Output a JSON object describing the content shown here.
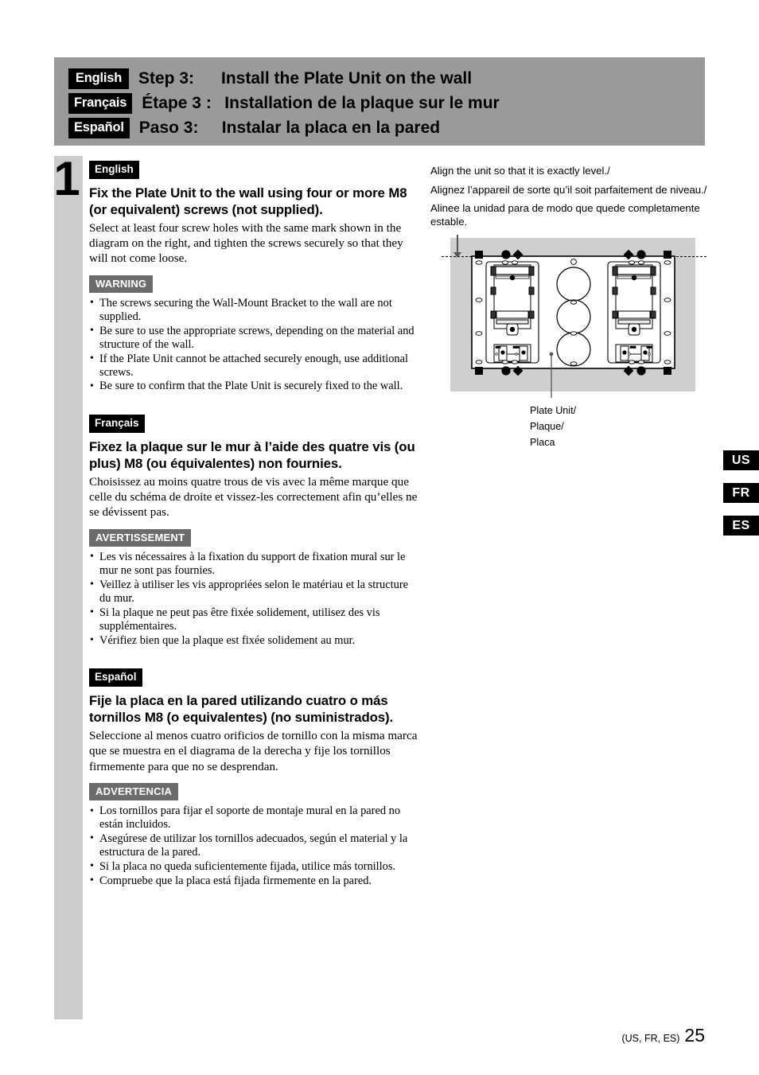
{
  "header": {
    "rows": [
      {
        "chip": "English",
        "step": "Step 3:",
        "title": "Install the Plate Unit on the wall"
      },
      {
        "chip": "Français",
        "step": "Étape 3 :",
        "title": "Installation de la plaque sur le mur"
      },
      {
        "chip": "Español",
        "step": "Paso 3:",
        "title": "Instalar la placa en la pared"
      }
    ],
    "band_color": "#9a9a9a"
  },
  "step": {
    "number": "1",
    "bar_color": "#cccccc"
  },
  "sections": [
    {
      "lang": "English",
      "heading": "Fix the Plate Unit to the wall using four or more M8 (or equivalent) screws (not supplied).",
      "body": "Select at least four screw holes with the same mark shown in the diagram on the right, and tighten the screws securely so that they will not come loose.",
      "warning_label": "WARNING",
      "bullets": [
        "The screws securing the Wall-Mount Bracket to the wall are not supplied.",
        "Be sure to use the appropriate screws, depending on the material and structure of the wall.",
        "If the Plate Unit cannot be attached securely enough, use additional screws.",
        "Be sure to confirm that the Plate Unit is securely fixed to the wall."
      ]
    },
    {
      "lang": "Français",
      "heading": "Fixez la plaque sur le mur à l’aide des quatre vis (ou plus) M8 (ou équivalentes) non fournies.",
      "body": "Choisissez au moins quatre trous de vis avec la même marque que celle du schéma de droite et vissez-les correctement afin qu’elles ne se dévissent pas.",
      "warning_label": "AVERTISSEMENT",
      "bullets": [
        "Les vis nécessaires à la fixation du support de fixation mural sur le mur ne sont pas fournies.",
        "Veillez à utiliser les vis appropriées selon le matériau et la structure du mur.",
        "Si la plaque ne peut pas être fixée solidement, utilisez des vis supplémentaires.",
        "Vérifiez bien que la plaque est fixée solidement au mur."
      ]
    },
    {
      "lang": "Español",
      "heading": "Fije la placa en la pared utilizando cuatro o más tornillos M8 (o equivalentes) (no suministrados).",
      "body": "Seleccione al menos cuatro orificios de tornillo con la misma marca que se muestra en el diagrama de la derecha y fije los tornillos firmemente para que no se desprendan.",
      "warning_label": "ADVERTENCIA",
      "bullets": [
        "Los tornillos para fijar el soporte de montaje mural en la pared no están incluidos.",
        "Asegúrese de utilizar los tornillos adecuados, según el material y la estructura de la pared.",
        "Si la placa no queda suficientemente fijada, utilice más tornillos.",
        "Compruebe que la placa está fijada firmemente en la pared."
      ]
    }
  ],
  "right": {
    "notes": [
      "Align the unit so that it is exactly level./",
      "Alignez l’appareil de sorte qu’il soit parfaitement de niveau./",
      "Alinee la unidad para de modo que quede completamente estable."
    ],
    "diagram": {
      "callout": "Plate Unit/\nPlaque/\nPlaca",
      "callout_lines": [
        "Plate Unit/",
        "Plaque/",
        "Placa"
      ],
      "background_color": "#cfcfcf",
      "marks": [
        "square",
        "circle",
        "diamond"
      ]
    }
  },
  "side_tabs": [
    {
      "label": "US"
    },
    {
      "label": "FR"
    },
    {
      "label": "ES"
    }
  ],
  "footer": {
    "langs": "(US, FR, ES)",
    "page": "25"
  }
}
